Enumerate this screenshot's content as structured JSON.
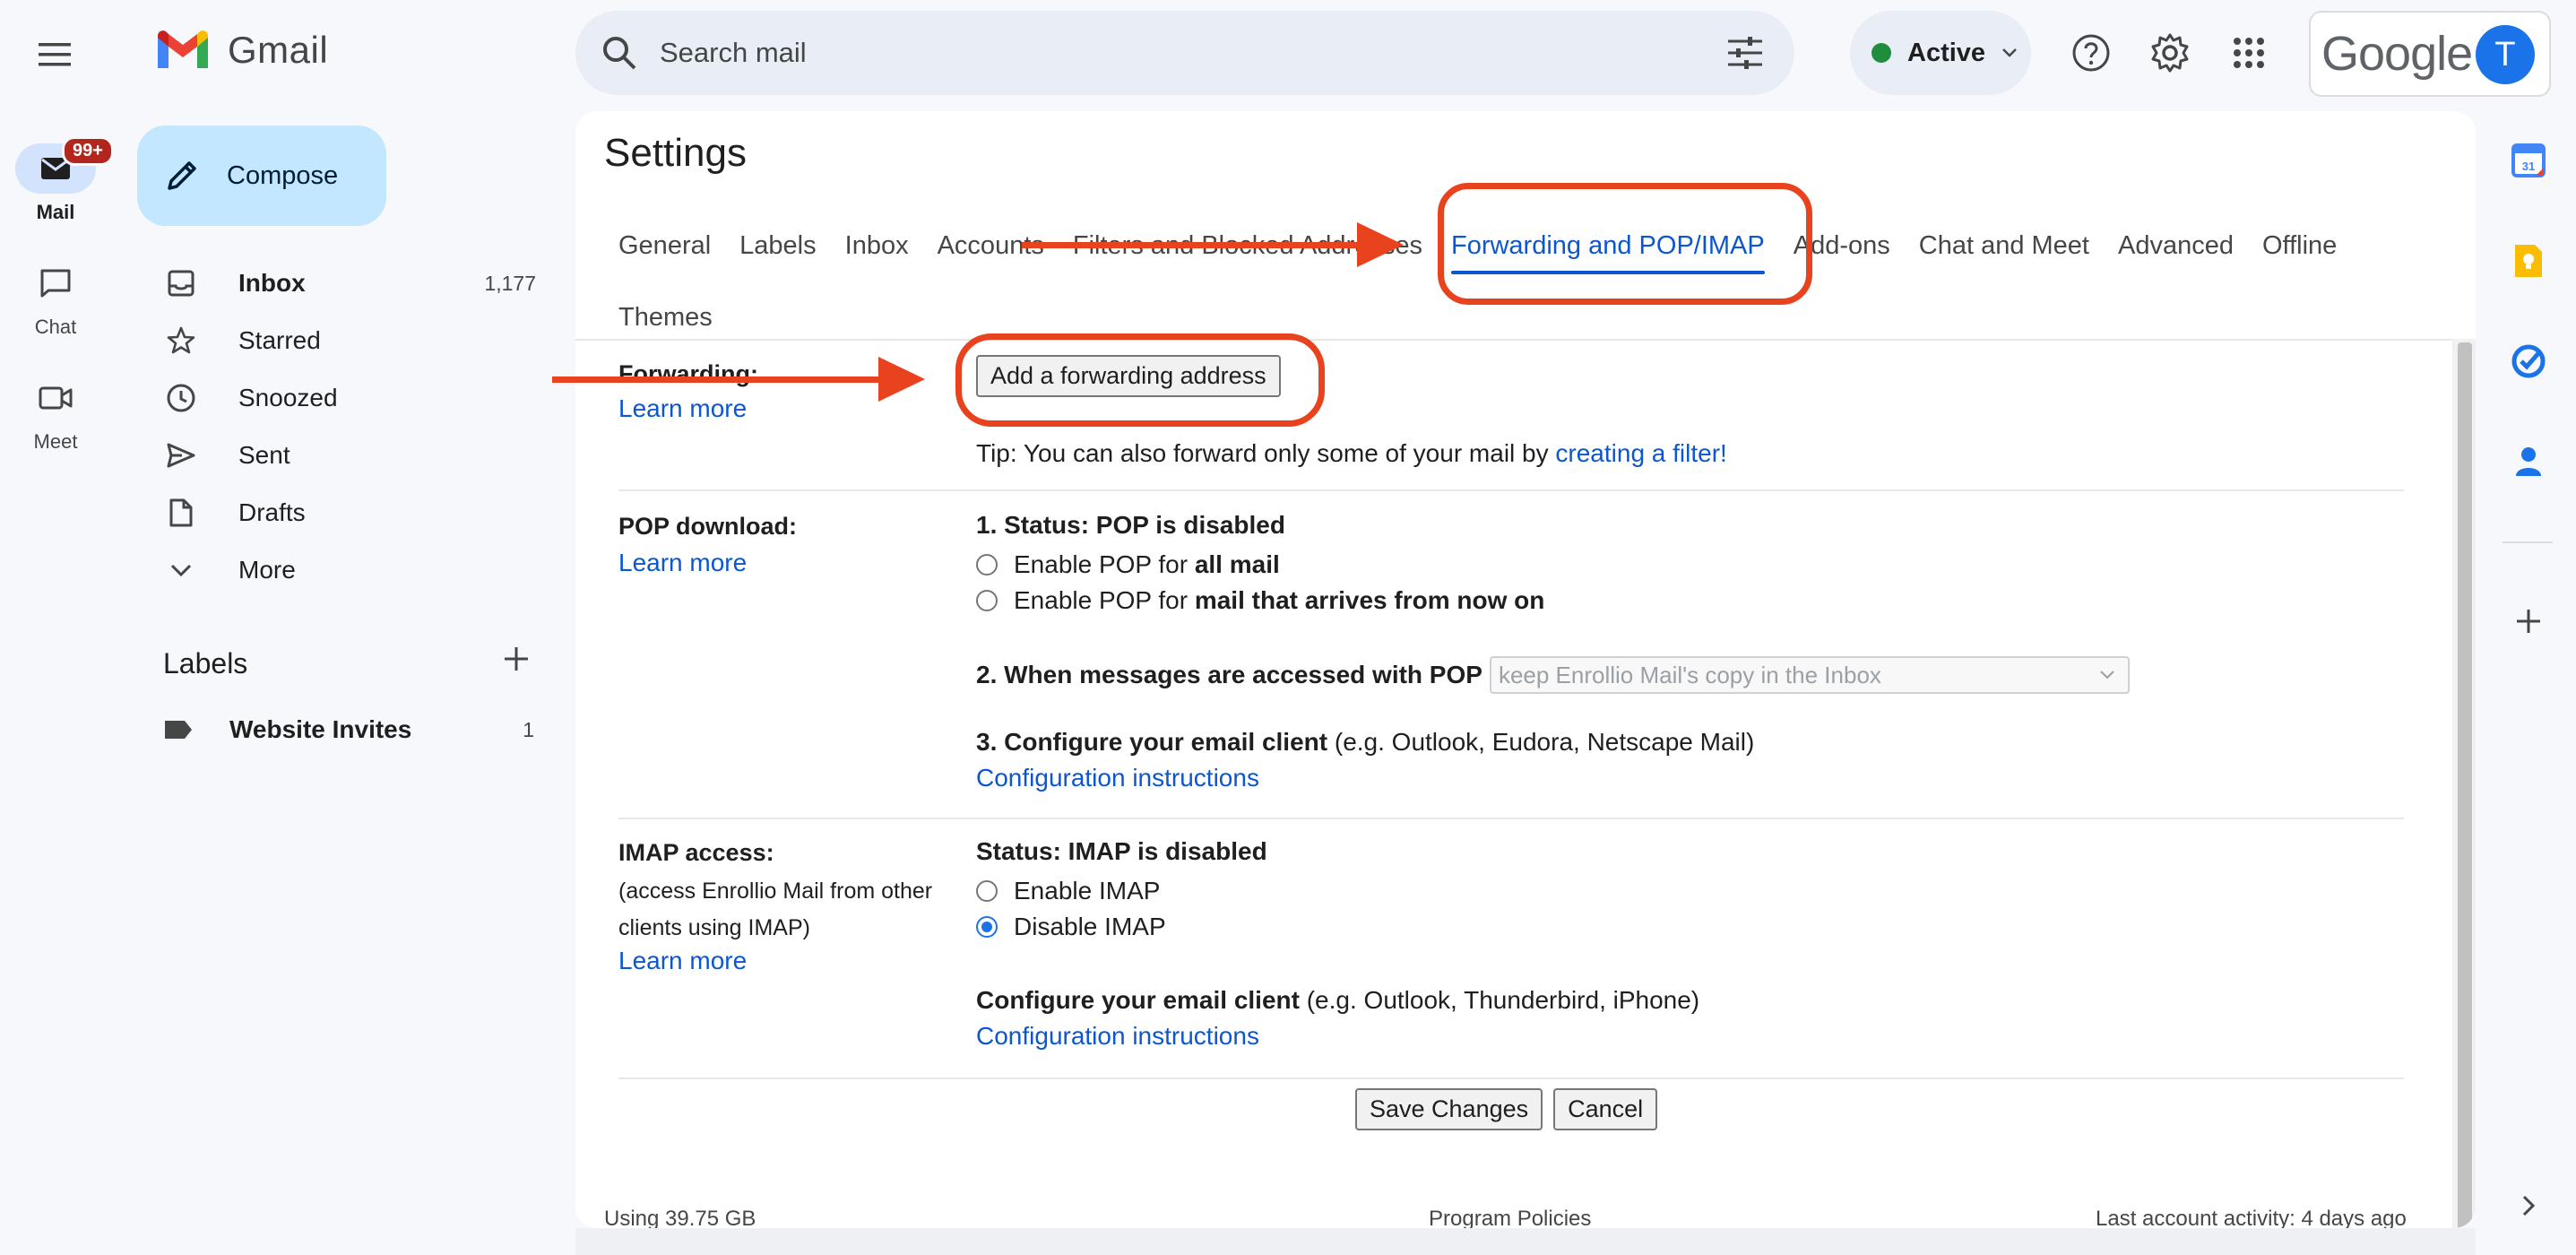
{
  "app": {
    "name": "Gmail"
  },
  "rail": [
    {
      "label": "Mail",
      "badge": "99+",
      "icon": "mail-icon"
    },
    {
      "label": "Chat",
      "icon": "chat-icon"
    },
    {
      "label": "Meet",
      "icon": "meet-icon"
    }
  ],
  "compose": {
    "label": "Compose"
  },
  "nav": [
    {
      "label": "Inbox",
      "count": "1,177",
      "icon": "inbox-icon"
    },
    {
      "label": "Starred",
      "count": "",
      "icon": "star-icon"
    },
    {
      "label": "Snoozed",
      "count": "",
      "icon": "clock-icon"
    },
    {
      "label": "Sent",
      "count": "",
      "icon": "send-icon"
    },
    {
      "label": "Drafts",
      "count": "",
      "icon": "draft-icon"
    },
    {
      "label": "More",
      "count": "",
      "icon": "chevron-down-icon"
    }
  ],
  "labels": {
    "title": "Labels",
    "items": [
      {
        "label": "Website Invites",
        "count": "1"
      }
    ]
  },
  "search": {
    "placeholder": "Search mail"
  },
  "status": {
    "label": "Active",
    "color": "#1e8e3e"
  },
  "account": {
    "brand": "Google",
    "initial": "T"
  },
  "settings": {
    "title": "Settings",
    "tabs": [
      "General",
      "Labels",
      "Inbox",
      "Accounts",
      "Filters and Blocked Addresses",
      "Forwarding and POP/IMAP",
      "Add-ons",
      "Chat and Meet",
      "Advanced",
      "Offline",
      "Themes"
    ],
    "active_tab": "Forwarding and POP/IMAP",
    "forwarding": {
      "label": "Forwarding:",
      "learn_more": "Learn more",
      "button": "Add a forwarding address",
      "tip_text": "Tip: You can also forward only some of your mail by ",
      "tip_link": "creating a filter!"
    },
    "pop": {
      "label": "POP download:",
      "learn_more": "Learn more",
      "status": "1. Status: POP is disabled",
      "opt1_prefix": "Enable POP for ",
      "opt1_bold": "all mail",
      "opt2_prefix": "Enable POP for ",
      "opt2_bold": "mail that arrives from now on",
      "step2": "2. When messages are accessed with POP",
      "step2_select": "keep Enrollio Mail's copy in the Inbox",
      "step3_bold": "3. Configure your email client",
      "step3_rest": " (e.g. Outlook, Eudora, Netscape Mail)",
      "config_link": "Configuration instructions"
    },
    "imap": {
      "label": "IMAP access:",
      "sub": "(access Enrollio Mail from other clients using IMAP)",
      "learn_more": "Learn more",
      "status": "Status: IMAP is disabled",
      "opt_enable": "Enable IMAP",
      "opt_disable": "Disable IMAP",
      "selected": "Disable IMAP",
      "client_bold": "Configure your email client",
      "client_rest": " (e.g. Outlook, Thunderbird, iPhone)",
      "config_link": "Configuration instructions"
    },
    "save": "Save Changes",
    "cancel": "Cancel"
  },
  "footer": {
    "storage": "Using 39.75 GB",
    "policies": "Program Policies",
    "activity": "Last account activity: 4 days ago"
  },
  "side_panel": [
    "calendar-icon",
    "keep-icon",
    "tasks-icon",
    "contacts-icon",
    "add-icon"
  ],
  "colors": {
    "accent": "#0b57d0",
    "annotation": "#e8431e",
    "compose_bg": "#c2e7ff"
  }
}
